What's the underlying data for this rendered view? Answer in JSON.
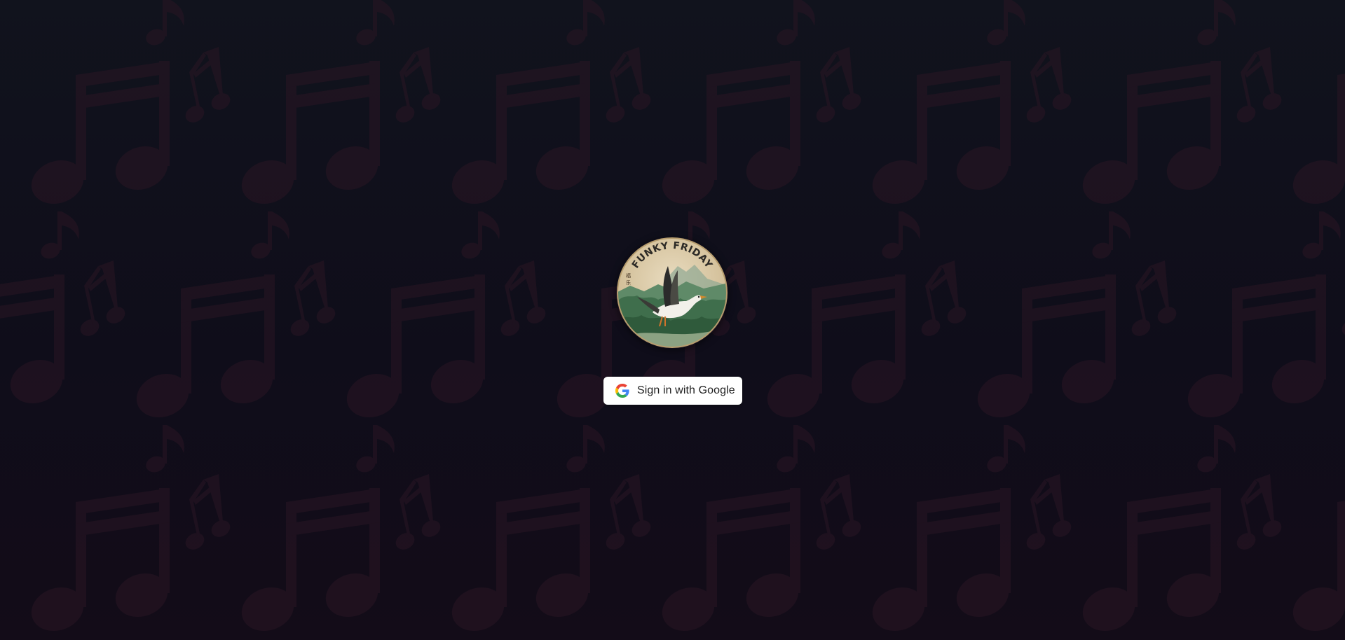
{
  "page": {
    "background_top": "#11131d",
    "background_bottom": "#130c18",
    "pattern_color": "#2a1624",
    "pattern_icon": "music-notes-icon"
  },
  "logo": {
    "text": "FUNKY FRIDAY",
    "seal_text": "福 乐",
    "illustration": "flying-goose-over-misty-mountains",
    "border_color": "#b79d6e"
  },
  "auth": {
    "button_label": "Sign in with Google",
    "button_icon": "google-g-icon",
    "colors": {
      "blue": "#4285F4",
      "red": "#EA4335",
      "yellow": "#FBBC05",
      "green": "#34A853"
    }
  }
}
